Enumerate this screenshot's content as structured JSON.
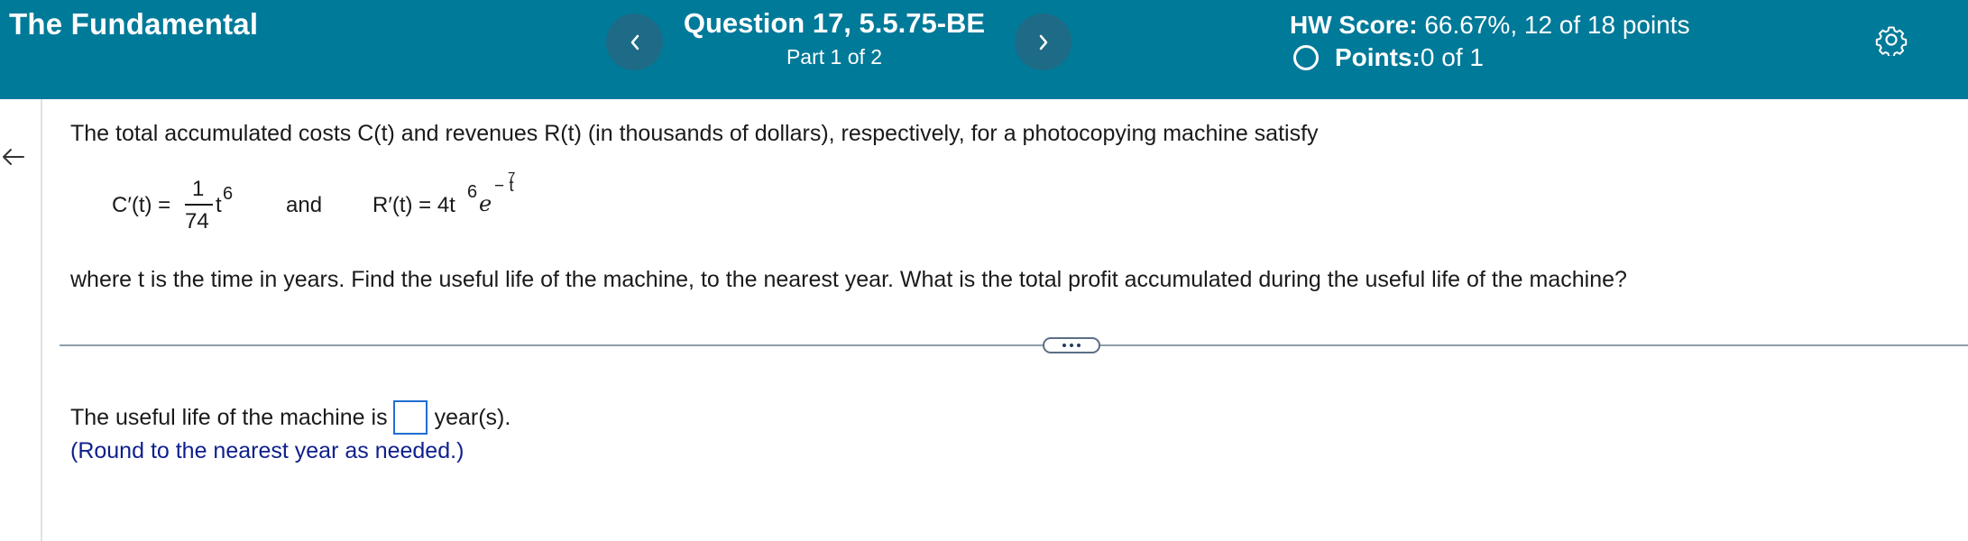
{
  "header": {
    "app_title": "The Fundamental",
    "question_title": "Question 17, 5.5.75-BE",
    "question_part": "Part 1 of 2",
    "score_label": "HW Score:",
    "score_value": " 66.67%, 12 of 18 points",
    "points_label": "Points:",
    "points_value": " 0 of 1",
    "prev_icon": "chevron-left-icon",
    "next_icon": "chevron-right-icon",
    "settings_icon": "gear-icon",
    "bg_color": "#007a99"
  },
  "problem": {
    "intro": "The total accumulated costs C(t) and revenues R(t) (in thousands of dollars), respectively, for a photocopying machine satisfy",
    "formula": {
      "c_lhs": "C′(t) =",
      "c_num": "1",
      "c_den": "74",
      "c_var": "t",
      "c_exp": "6",
      "and": "and",
      "r_lhs": "R′(t) = 4t",
      "r_exp": "6",
      "r_e": "e",
      "r_e_exp": "− t",
      "r_inner_exp": "7"
    },
    "question": "where t is the time in years. Find the useful life of the machine, to the nearest year. What is the total profit accumulated during the useful life of the machine?"
  },
  "answer": {
    "prefix": "The useful life of the machine is",
    "input_value": "",
    "suffix": "year(s).",
    "hint": "(Round to the nearest year as needed.)"
  }
}
